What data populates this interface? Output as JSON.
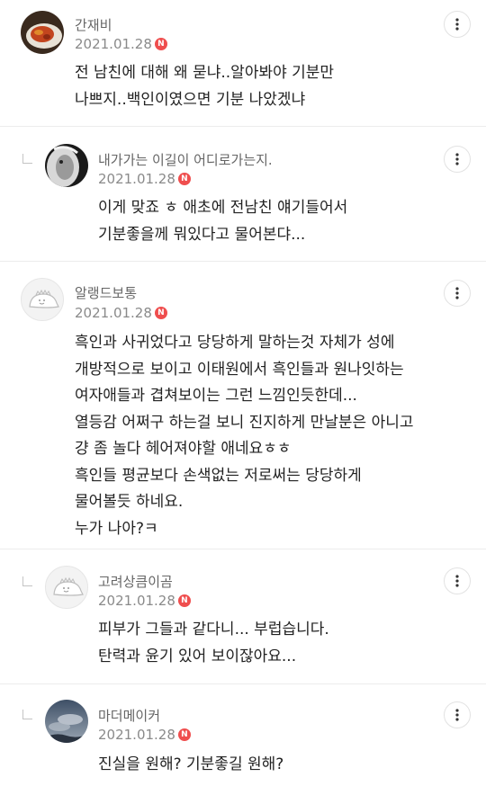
{
  "comments": [
    {
      "nickname": "간재비",
      "date": "2021.01.28",
      "badge": "N",
      "avatar_icon": "food-photo-avatar",
      "lines": [
        "전 남친에 대해 왜 묻냐..알아봐야 기분만",
        "나쁘지..백인이였으면 기분 나았겠냐"
      ]
    },
    {
      "nickname": "내가가는 이길이 어디로가는지.",
      "date": "2021.01.28",
      "badge": "N",
      "avatar_icon": "lion-photo-avatar",
      "lines": [
        "이게 맞죠 ㅎ 애초에 전남친 얘기들어서",
        "기분좋을께 뭐있다고 물어본댜..."
      ]
    },
    {
      "nickname": "알랭드보통",
      "date": "2021.01.28",
      "badge": "N",
      "avatar_icon": "dino-avatar",
      "lines": [
        "흑인과 사귀었다고 당당하게 말하는것 자체가 성에",
        "개방적으로 보이고 이태원에서 흑인들과 원나잇하는",
        "여자애들과 겹쳐보이는 그런 느낌인듯한데...",
        "열등감 어쩌구 하는걸 보니 진지하게 만날분은 아니고",
        "걍 좀 놀다 헤어져야할 애네요ㅎㅎ",
        "흑인들 평균보다 손색없는 저로써는 당당하게",
        "물어볼듯 하네요.",
        "누가 나아?ㅋ"
      ]
    },
    {
      "nickname": "고려상큼이곰",
      "date": "2021.01.28",
      "badge": "N",
      "avatar_icon": "dino-avatar",
      "lines": [
        "피부가 그들과 같다니... 부럽습니다.",
        "탄력과 윤기 있어 보이잖아요..."
      ]
    },
    {
      "nickname": "마더메이커",
      "date": "2021.01.28",
      "badge": "N",
      "avatar_icon": "sky-photo-avatar",
      "lines": [
        "진실을 원해? 기분좋길 원해?"
      ]
    }
  ],
  "colors": {
    "badge": "#ef4e4e",
    "divider": "#ececec",
    "nickname": "#666666",
    "date": "#8a8a8a"
  },
  "icons": {
    "more": "more-vertical-icon",
    "reply": "reply-indent-icon"
  }
}
